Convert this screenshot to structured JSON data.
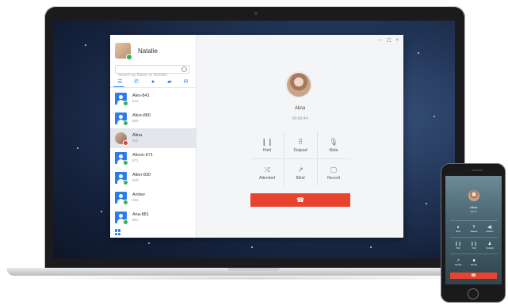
{
  "window": {
    "minimize": "–",
    "maximize": "☐",
    "close": "×"
  },
  "user": {
    "name": "Natalie"
  },
  "search": {
    "placeholder": "Search by Name or Number"
  },
  "tabs": [
    {
      "name": "list-icon",
      "glyph": "☰"
    },
    {
      "name": "phone-icon",
      "glyph": "✆"
    },
    {
      "name": "chat-icon",
      "glyph": "●"
    },
    {
      "name": "voicemail-icon",
      "glyph": "▰"
    },
    {
      "name": "mail-icon",
      "glyph": "✉"
    }
  ],
  "contacts": [
    {
      "name": "Alex-841",
      "ext": "841"
    },
    {
      "name": "Alice-880",
      "ext": "880"
    },
    {
      "name": "Alina",
      "ext": "844"
    },
    {
      "name": "Alison-871",
      "ext": "871"
    },
    {
      "name": "Allen-830",
      "ext": "830"
    },
    {
      "name": "Amber",
      "ext": "852"
    },
    {
      "name": "Ana-881",
      "ext": "881"
    }
  ],
  "call": {
    "callee": "Alina",
    "timer": "00:00:44",
    "controls": [
      {
        "label": "Hold",
        "icon": "pause-icon",
        "glyph": "❙❙"
      },
      {
        "label": "Dialpad",
        "icon": "dialpad-icon",
        "glyph": "⠿"
      },
      {
        "label": "Mute",
        "icon": "mute-icon",
        "glyph": "🎙"
      },
      {
        "label": "Attended",
        "icon": "attended-transfer-icon",
        "glyph": "⤨"
      },
      {
        "label": "Blind",
        "icon": "blind-transfer-icon",
        "glyph": "↗"
      },
      {
        "label": "Record",
        "icon": "record-icon",
        "glyph": "▢"
      }
    ],
    "hangup_glyph": "☎"
  },
  "colors": {
    "accent": "#2b7de9",
    "hangup": "#e8432f",
    "online": "#34b24f"
  },
  "phone": {
    "callee": "Alina",
    "timer": "00:44",
    "controls": [
      {
        "label": "Mute",
        "glyph": "●"
      },
      {
        "label": "Dialpad",
        "glyph": "⠿"
      },
      {
        "label": "Speaker",
        "glyph": "◀)"
      },
      {
        "label": "Hold",
        "glyph": "❙❙"
      },
      {
        "label": "Hold",
        "glyph": "❙❙"
      },
      {
        "label": "Contacts",
        "glyph": "♟"
      },
      {
        "label": "Transfer",
        "glyph": "↗"
      },
      {
        "label": "Record",
        "glyph": "■"
      },
      {
        "label": "",
        "glyph": ""
      }
    ]
  }
}
